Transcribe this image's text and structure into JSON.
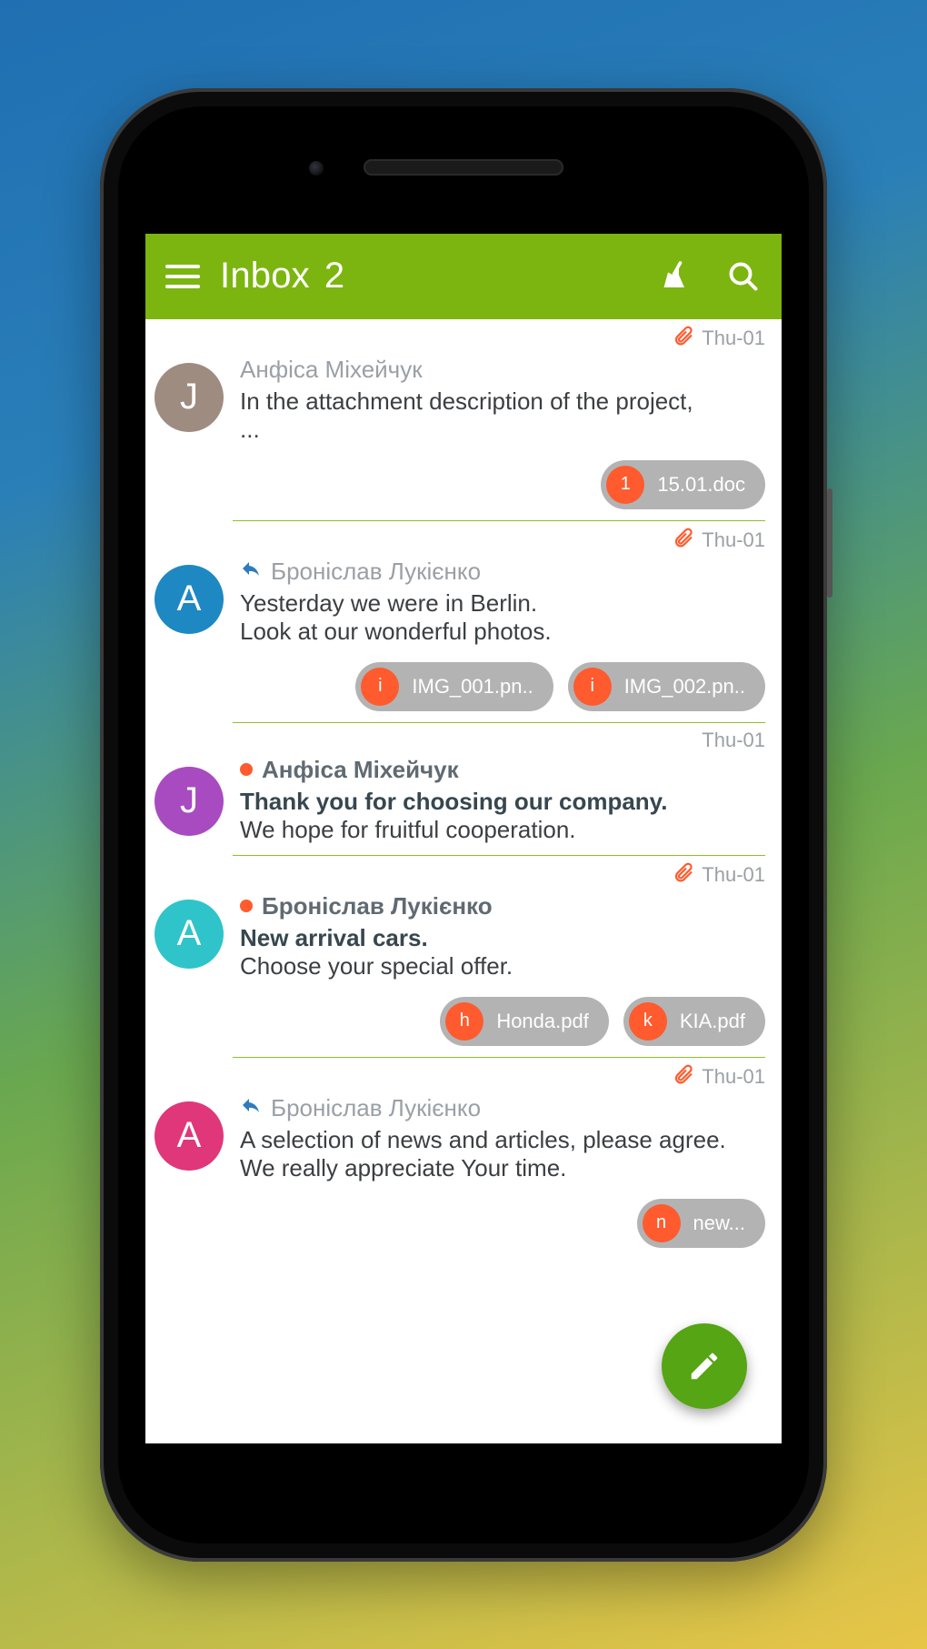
{
  "appbar": {
    "title": "Inbox",
    "count": "2"
  },
  "icons": {
    "menu": "menu-icon",
    "sweep": "sweep-icon",
    "search": "search-icon",
    "compose": "compose-icon",
    "clip": "attachment-icon",
    "reply": "reply-icon"
  },
  "colors": {
    "accent": "#7cb50f",
    "chip_bullet": "#ff5b2e",
    "fab": "#55a514"
  },
  "messages": [
    {
      "avatar_letter": "J",
      "avatar_color": "#9e8c80",
      "has_clip": true,
      "date": "Thu-01",
      "replied": false,
      "unread": false,
      "sender": "Анфіса Міхейчук",
      "line1": "In the attachment description of the project,",
      "line2": "...",
      "attachments": [
        {
          "bullet": "1",
          "label": "15.01.doc"
        }
      ]
    },
    {
      "avatar_letter": "A",
      "avatar_color": "#1e88c3",
      "has_clip": true,
      "date": "Thu-01",
      "replied": true,
      "unread": false,
      "sender": "Броніслав Лукієнко",
      "line1": "Yesterday we were in Berlin.",
      "line2": "Look at our wonderful photos.",
      "attachments": [
        {
          "bullet": "i",
          "label": "IMG_001.pn.."
        },
        {
          "bullet": "i",
          "label": "IMG_002.pn.."
        }
      ]
    },
    {
      "avatar_letter": "J",
      "avatar_color": "#a94bc0",
      "has_clip": false,
      "date": "Thu-01",
      "replied": false,
      "unread": true,
      "sender": "Анфіса Міхейчук",
      "line1": "Thank you for choosing our company.",
      "line2": "We hope for fruitful cooperation.",
      "attachments": []
    },
    {
      "avatar_letter": "A",
      "avatar_color": "#2ec4c9",
      "has_clip": true,
      "date": "Thu-01",
      "replied": false,
      "unread": true,
      "sender": "Броніслав Лукієнко",
      "line1": "New arrival cars.",
      "line2": "Choose your special offer.",
      "attachments": [
        {
          "bullet": "h",
          "label": "Honda.pdf"
        },
        {
          "bullet": "k",
          "label": "KIA.pdf"
        }
      ]
    },
    {
      "avatar_letter": "A",
      "avatar_color": "#e0367a",
      "has_clip": true,
      "date": "Thu-01",
      "replied": true,
      "unread": false,
      "sender": "Броніслав Лукієнко",
      "line1": "A selection of news and articles, please agree.",
      "line2": "We really appreciate Your time.",
      "attachments": [
        {
          "bullet": "n",
          "label": "new..."
        }
      ]
    }
  ]
}
